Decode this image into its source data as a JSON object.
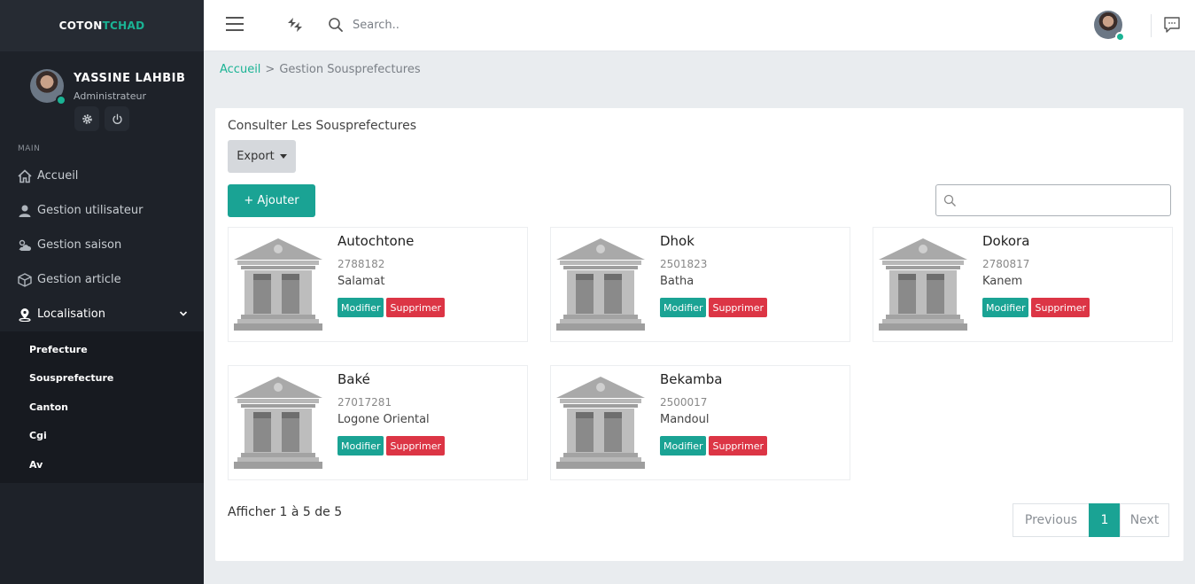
{
  "brand": {
    "part1": "COTON",
    "part2": "TCHAD"
  },
  "user": {
    "name": "YASSINE LAHBIB",
    "role": "Administrateur"
  },
  "sidebar": {
    "section_label": "MAIN",
    "items": [
      {
        "label": "Accueil",
        "icon": "home-icon"
      },
      {
        "label": "Gestion utilisateur",
        "icon": "user-icon"
      },
      {
        "label": "Gestion saison",
        "icon": "weather-icon"
      },
      {
        "label": "Gestion article",
        "icon": "box-icon"
      },
      {
        "label": "Localisation",
        "icon": "location-icon"
      }
    ],
    "submenu": [
      "Prefecture",
      "Sousprefecture",
      "Canton",
      "Cgi",
      "Av"
    ]
  },
  "topbar": {
    "search_placeholder": "Search.."
  },
  "breadcrumb": {
    "home": "Accueil",
    "separator": ">",
    "current": "Gestion Sousprefectures"
  },
  "main": {
    "title": "Consulter Les Sousprefectures",
    "export_label": "Export",
    "add_label": "+ Ajouter",
    "items": [
      {
        "name": "Autochtone",
        "code": "2788182",
        "region": "Salamat"
      },
      {
        "name": "Dhok",
        "code": "2501823",
        "region": "Batha"
      },
      {
        "name": "Dokora",
        "code": "2780817",
        "region": "Kanem"
      },
      {
        "name": "Baké",
        "code": "27017281",
        "region": "Logone Oriental"
      },
      {
        "name": "Bekamba",
        "code": "2500017",
        "region": "Mandoul"
      }
    ],
    "modify_label": "Modifier",
    "delete_label": "Supprimer",
    "pager_info": "Afficher 1 à 5 de 5",
    "pager": {
      "previous": "Previous",
      "current": "1",
      "next": "Next"
    }
  },
  "colors": {
    "accent": "#1aa394",
    "danger": "#dc3545",
    "sidebar_bg": "#1e2229"
  }
}
